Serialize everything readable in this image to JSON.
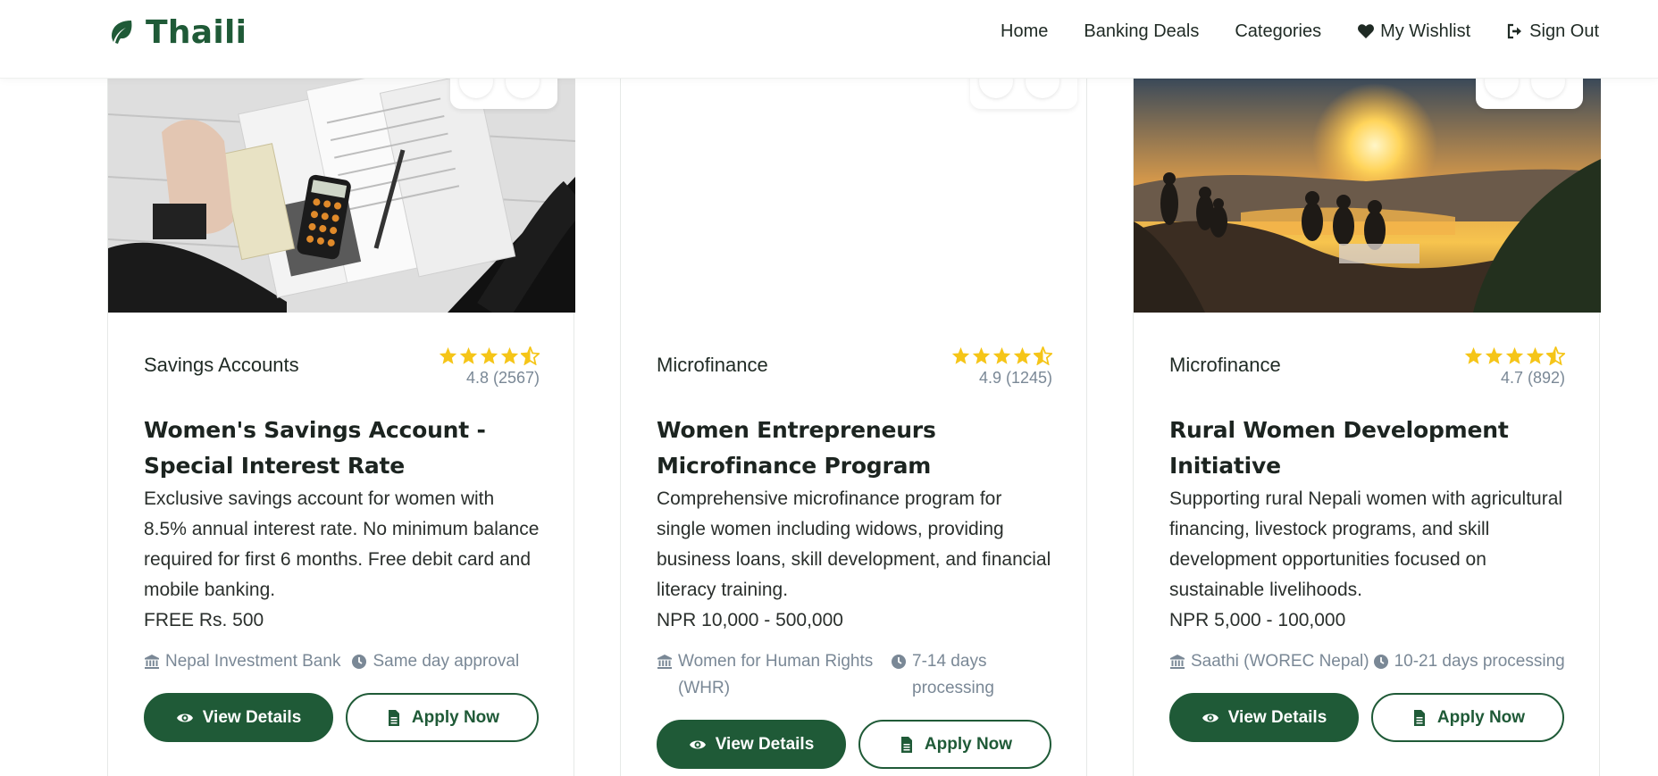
{
  "brand": {
    "name": "Thaili",
    "icon": "leaf-icon",
    "color": "#1f5a37"
  },
  "nav": {
    "items": [
      {
        "label": "Home",
        "icon": null
      },
      {
        "label": "Banking Deals",
        "icon": null
      },
      {
        "label": "Categories",
        "icon": null
      },
      {
        "label": "My Wishlist",
        "icon": "heart-icon"
      },
      {
        "label": "Sign Out",
        "icon": "sign-out-icon"
      }
    ]
  },
  "cards": [
    {
      "image": "savings-documents-photo",
      "category": "Savings Accounts",
      "rating_value": 4.5,
      "rating_text": "4.8 (2567)",
      "title": "Women's Savings Account - Special Interest Rate",
      "description": "Exclusive savings account for women with 8.5% annual interest rate. No minimum balance required for first 6 months. Free debit card and mobile banking.",
      "amount": "FREE Rs. 500",
      "provider": "Nepal Investment Bank",
      "processing": "Same day approval",
      "view_label": "View Details",
      "apply_label": "Apply Now"
    },
    {
      "image": "blank",
      "category": "Microfinance",
      "rating_value": 4.5,
      "rating_text": "4.9 (1245)",
      "title": "Women Entrepreneurs Microfinance Program",
      "description": "Comprehensive microfinance program for single women including widows, providing business loans, skill development, and financial literacy training.",
      "amount": "NPR 10,000 - 500,000",
      "provider": "Women for Human Rights (WHR)",
      "processing": "7-14 days processing",
      "view_label": "View Details",
      "apply_label": "Apply Now"
    },
    {
      "image": "sunset-hill-photo",
      "category": "Microfinance",
      "rating_value": 4.5,
      "rating_text": "4.7 (892)",
      "title": "Rural Women Development Initiative",
      "description": "Supporting rural Nepali women with agricultural financing, livestock programs, and skill development opportunities focused on sustainable livelihoods.",
      "amount": "NPR 5,000 - 100,000",
      "provider": "Saathi (WOREC Nepal)",
      "processing": "10-21 days processing",
      "view_label": "View Details",
      "apply_label": "Apply Now"
    }
  ],
  "colors": {
    "accent": "#1f5a37",
    "star": "#f5c518",
    "muted": "#7a8896"
  }
}
